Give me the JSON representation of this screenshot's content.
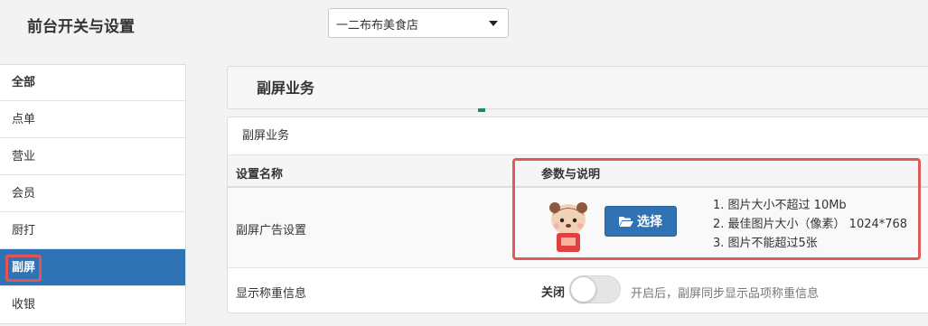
{
  "page": {
    "title": "前台开关与设置"
  },
  "store_select": {
    "selected": "一二布布美食店"
  },
  "sidebar": {
    "items": [
      {
        "label": "全部"
      },
      {
        "label": "点单"
      },
      {
        "label": "营业"
      },
      {
        "label": "会员"
      },
      {
        "label": "厨打"
      },
      {
        "label": "副屏"
      },
      {
        "label": "收银"
      }
    ],
    "active_index": 5
  },
  "section": {
    "title": "副屏业务"
  },
  "card": {
    "title": "副屏业务",
    "columns": {
      "name": "设置名称",
      "desc": "参数与说明"
    },
    "ad_setting": {
      "name": "副屏广告设置",
      "button_label": "选择",
      "button_icon": "folder-open-icon",
      "rules": [
        "1. 图片大小不超过 10Mb",
        "2. 最佳图片大小（像素） 1024*768",
        "3. 图片不能超过5张"
      ]
    },
    "weight_setting": {
      "name": "显示称重信息",
      "toggle_state_label": "关闭",
      "toggle_on": false,
      "hint": "开启后，副屏同步显示品项称重信息"
    }
  },
  "colors": {
    "accent": "#2f73b4",
    "highlight": "#e05a5a"
  }
}
